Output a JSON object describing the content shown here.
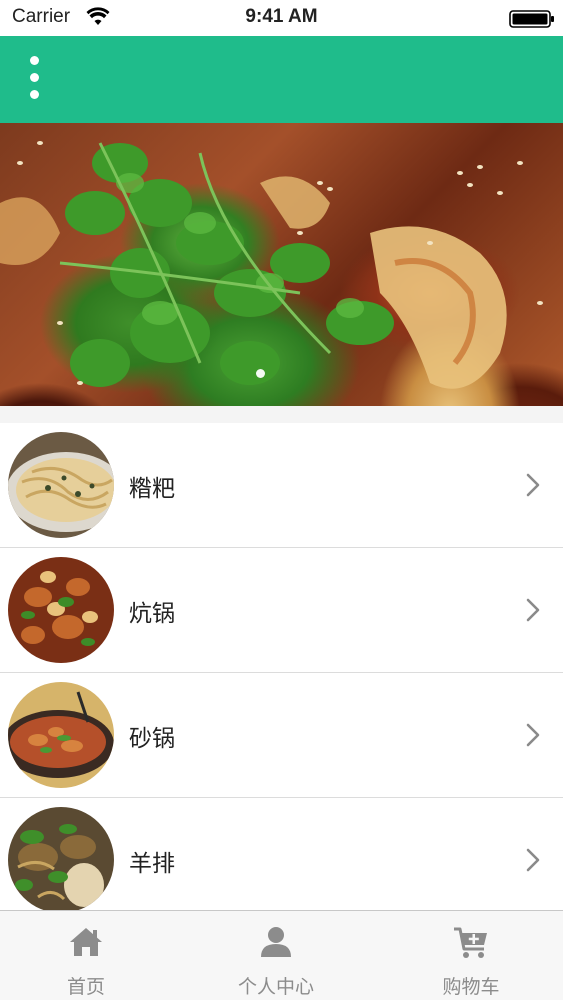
{
  "status_bar": {
    "carrier": "Carrier",
    "time": "9:41 AM"
  },
  "nav": {
    "menu_icon": "more-vertical-icon",
    "color": "#1fbc8b"
  },
  "banner": {
    "image": "stir-fried-dish-with-cilantro-photo",
    "page_count": 1,
    "active_page": 1
  },
  "list": {
    "items": [
      {
        "label": "糌粑",
        "image": "noodles-in-bowl-photo"
      },
      {
        "label": "炕锅",
        "image": "dry-pot-dish-photo"
      },
      {
        "label": "砂锅",
        "image": "clay-pot-soup-photo"
      },
      {
        "label": "羊排",
        "image": "lamb-ribs-photo"
      }
    ],
    "chevron_icon": "chevron-right-icon"
  },
  "tab_bar": {
    "tabs": [
      {
        "label": "首页",
        "icon": "home-icon"
      },
      {
        "label": "个人中心",
        "icon": "user-icon"
      },
      {
        "label": "购物车",
        "icon": "cart-add-icon"
      }
    ]
  }
}
